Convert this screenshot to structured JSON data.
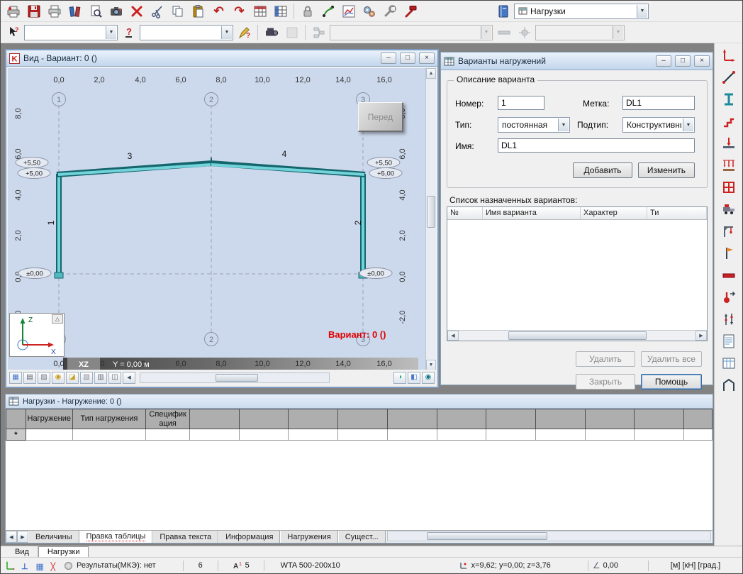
{
  "toolbar": {
    "loads_combo": "Нагрузки"
  },
  "view": {
    "title": "Вид - Вариант: 0 ()",
    "front_button": "Перед",
    "variant_overlay": "Вариант: 0 ()",
    "plane": "XZ",
    "y_readout": "Y = 0,00 м",
    "axis_z": "Z",
    "axis_x": "X",
    "top": [
      "0,0",
      "2,0",
      "4,0",
      "6,0",
      "8,0",
      "10,0",
      "12,0",
      "14,0",
      "16,0"
    ],
    "bottom": [
      "0,0",
      "2,0",
      "4,0",
      "6,0",
      "8,0",
      "10,0",
      "12,0",
      "14,0",
      "16,0"
    ],
    "left": [
      "8,0",
      "6,0",
      "4,0",
      "2,0",
      "0,0",
      "-2,0"
    ],
    "right": [
      "8,0",
      "6,0",
      "4,0",
      "2,0",
      "0,0",
      "-2,0"
    ],
    "axes": [
      "1",
      "2",
      "3"
    ],
    "elev": {
      "l1": "+5,50",
      "l2": "+5,00",
      "r1": "+5,50",
      "r2": "+5,00",
      "lb": "±0,00",
      "rb": "±0,00"
    },
    "members": [
      "1",
      "2",
      "3",
      "4"
    ]
  },
  "dialog": {
    "title": "Варианты нагружений",
    "group_title": "Описание варианта",
    "labels": {
      "number": "Номер:",
      "mark": "Метка:",
      "type": "Тип:",
      "subtype": "Подтип:",
      "name": "Имя:"
    },
    "values": {
      "number": "1",
      "mark": "DL1",
      "type": "постоянная",
      "subtype": "Конструктивные",
      "name": "DL1"
    },
    "buttons": {
      "add": "Добавить",
      "edit": "Изменить",
      "delete": "Удалить",
      "delete_all": "Удалить все",
      "close": "Закрыть",
      "help": "Помощь"
    },
    "list_caption": "Список назначенных вариантов:",
    "table_headers": [
      "№",
      "Имя варианта",
      "Характер",
      "Ти"
    ]
  },
  "panel": {
    "title": "Нагрузки - Нагружение: 0 ()",
    "columns": [
      "Нагружение",
      "Тип нагружения",
      "Спецификация"
    ],
    "new_row_marker": "*",
    "sheet_tabs": [
      "Величины",
      "Правка таблицы",
      "Правка текста",
      "Информация",
      "Нагружения",
      "Сущест..."
    ]
  },
  "tabs": {
    "view": "Вид",
    "loads": "Нагрузки"
  },
  "status": {
    "results": "Результаты(МКЭ): нет",
    "field1": "6",
    "field2": "5",
    "profile": "WTA 500-200x10",
    "coords": "x=9,62; y=0,00; z=3,76",
    "angle": "0,00",
    "units": "[м] [кН] [град.]"
  }
}
